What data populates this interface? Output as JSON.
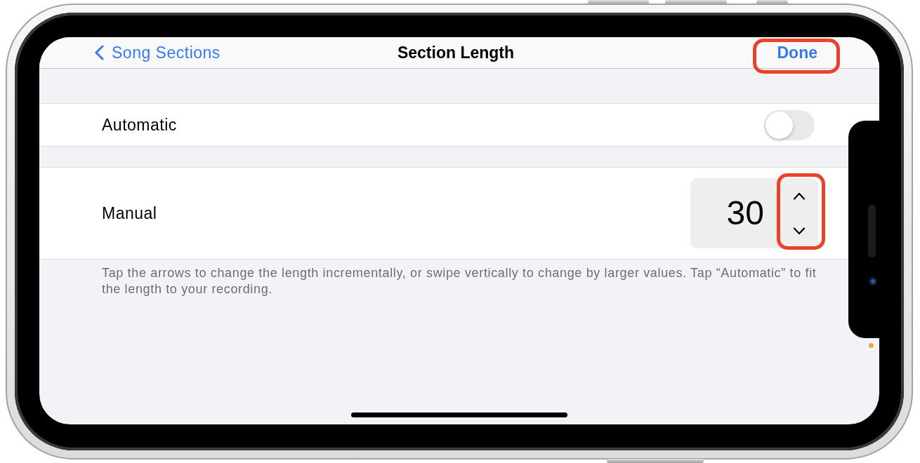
{
  "nav_bar": {
    "back": {
      "label": "Song Sections"
    },
    "title": "Section Length",
    "done": {
      "label": "Done",
      "highlighted": true
    }
  },
  "rows": [
    {
      "kind": "toggle",
      "label": "Automatic",
      "on": false
    },
    {
      "kind": "stepper",
      "label": "Manual",
      "value": "30",
      "highlighted": true
    }
  ],
  "footer": "Tap the arrows to change the length incrementally, or swipe vertically to change by larger values. Tap “Automatic” to fit the length to your recording.",
  "recording_indicator": true
}
